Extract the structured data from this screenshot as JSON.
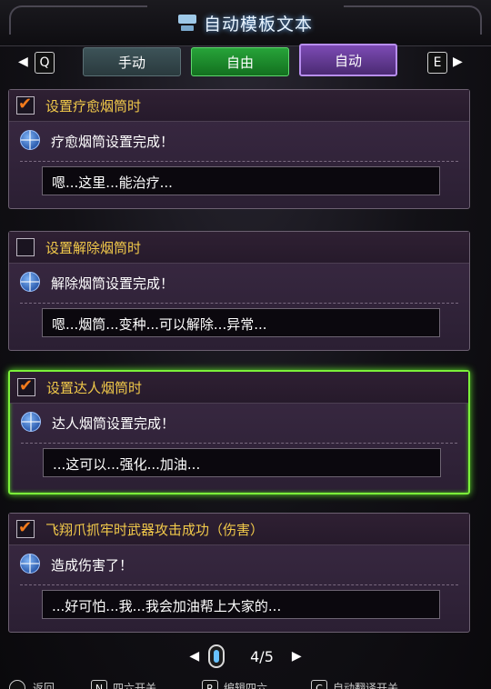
{
  "header": {
    "title": "自动模板文本"
  },
  "tabs": {
    "left_key": "Q",
    "right_key": "E",
    "items": [
      {
        "label": "手动"
      },
      {
        "label": "自由"
      },
      {
        "label": "自动"
      }
    ],
    "active": "自动"
  },
  "cards": [
    {
      "title": "设置疗愈烟筒时",
      "checked": true,
      "message": "疗愈烟筒设置完成！",
      "input": "嗯...这里...能治疗..."
    },
    {
      "title": "设置解除烟筒时",
      "checked": false,
      "message": "解除烟筒设置完成！",
      "input": "嗯...烟筒...变种...可以解除...异常..."
    },
    {
      "title": "设置达人烟筒时",
      "checked": true,
      "message": "达人烟筒设置完成！",
      "input": "...这可以...强化...加油..."
    },
    {
      "title": "飞翔爪抓牢时武器攻击成功（伤害）",
      "checked": true,
      "message": "造成伤害了！",
      "input": "...好可怕...我...我会加油帮上大家的..."
    }
  ],
  "pager": {
    "current": "4",
    "total": "5",
    "display": "4/5"
  },
  "footer": {
    "items": [
      {
        "key": "",
        "label": "返回"
      },
      {
        "key": "N",
        "label": "四六开关"
      },
      {
        "key": "R",
        "label": "编辑四六"
      },
      {
        "key": "C",
        "label": "自动翻译开关"
      }
    ]
  },
  "colors": {
    "selected_border": "#7cf03a",
    "card_title": "#f1c94a",
    "check": "#f37b1c"
  }
}
